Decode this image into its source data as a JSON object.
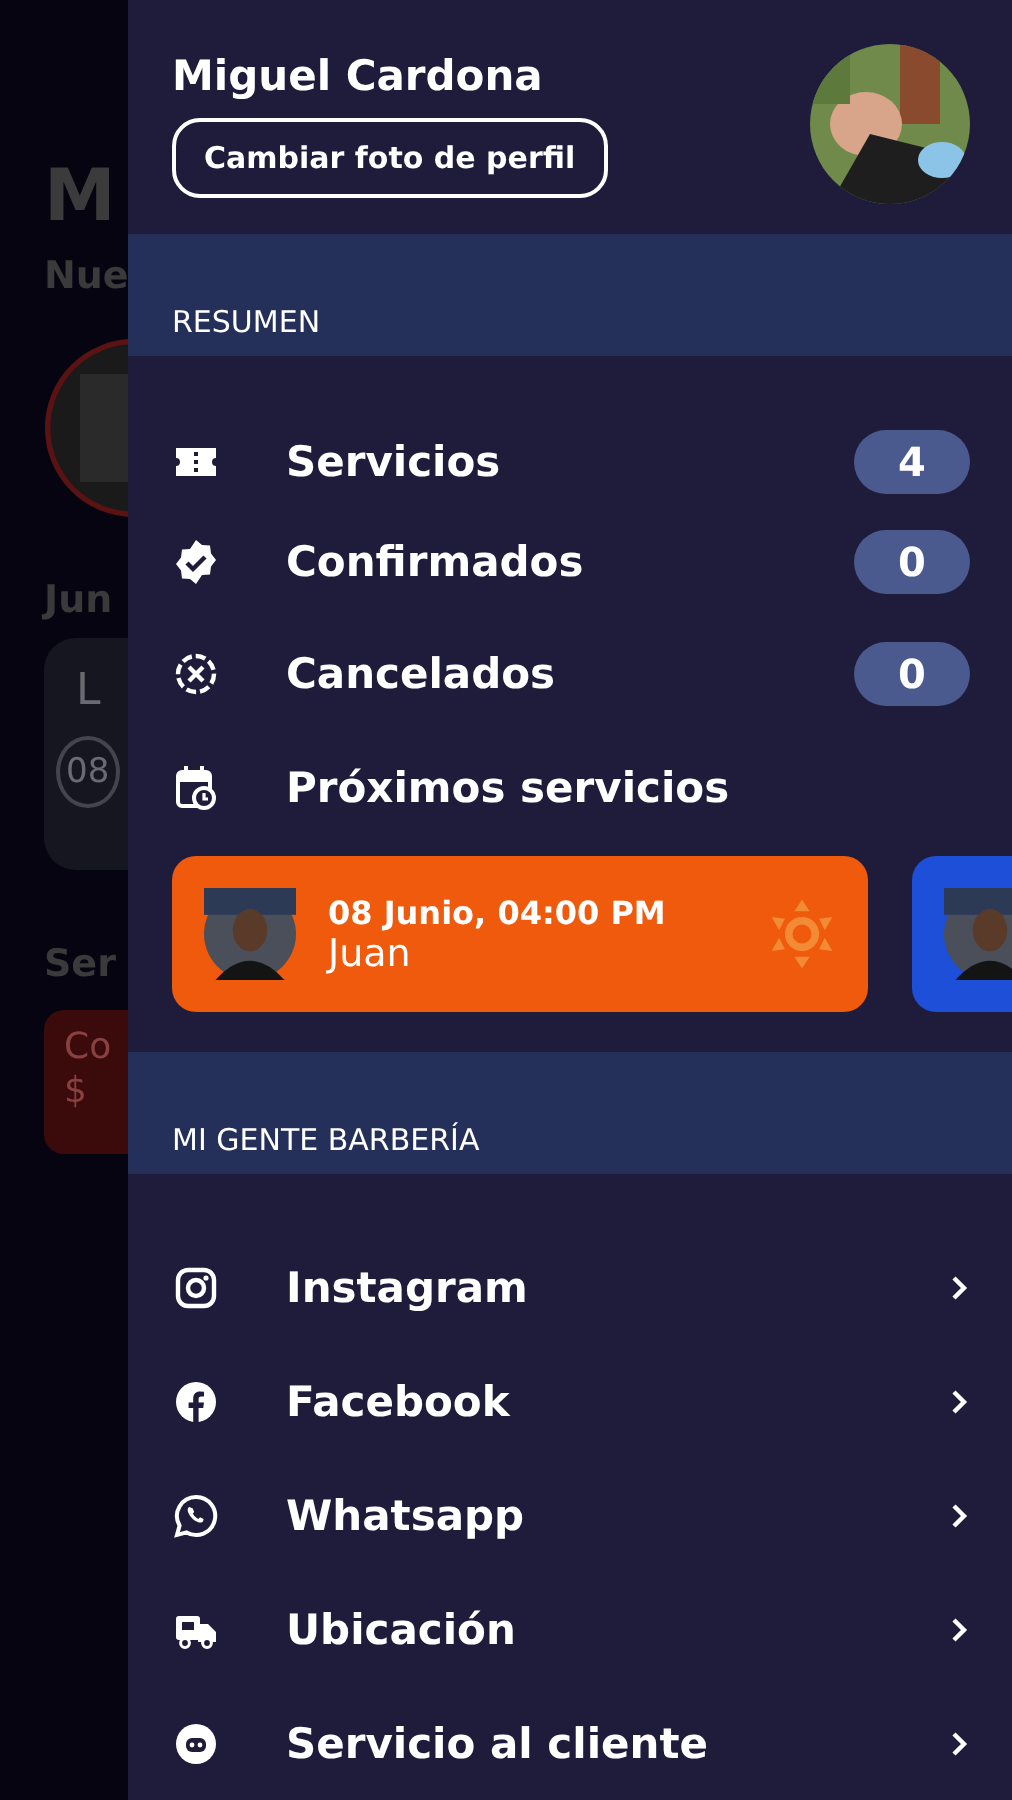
{
  "background_page": {
    "title": "M",
    "subtitle": "Nue",
    "date_label": "Jun",
    "day_card": {
      "letter": "L",
      "number": "08"
    },
    "section_label": "Ser",
    "price_card": {
      "label": "Co",
      "amount": "$"
    }
  },
  "drawer": {
    "user_name": "Miguel Cardona",
    "change_photo_button": "Cambiar foto de perfil",
    "summary": {
      "heading": "RESUMEN",
      "items": [
        {
          "kind": "ticket",
          "label": "Servicios",
          "count": "4"
        },
        {
          "kind": "verified",
          "label": "Confirmados",
          "count": "0"
        },
        {
          "kind": "cancel",
          "label": "Cancelados",
          "count": "0"
        },
        {
          "kind": "calendar",
          "label": "Próximos servicios"
        }
      ]
    },
    "upcoming": [
      {
        "date": "08 Junio, 04:00 PM",
        "name": "Juan",
        "color": "#f05a0c"
      },
      {
        "color": "#1d4fd8"
      }
    ],
    "shop": {
      "heading": "MI GENTE BARBERÍA",
      "links": [
        {
          "kind": "instagram",
          "label": "Instagram"
        },
        {
          "kind": "facebook",
          "label": "Facebook"
        },
        {
          "kind": "whatsapp",
          "label": "Whatsapp"
        },
        {
          "kind": "location",
          "label": "Ubicación"
        },
        {
          "kind": "support",
          "label": "Servicio al cliente"
        }
      ]
    }
  }
}
